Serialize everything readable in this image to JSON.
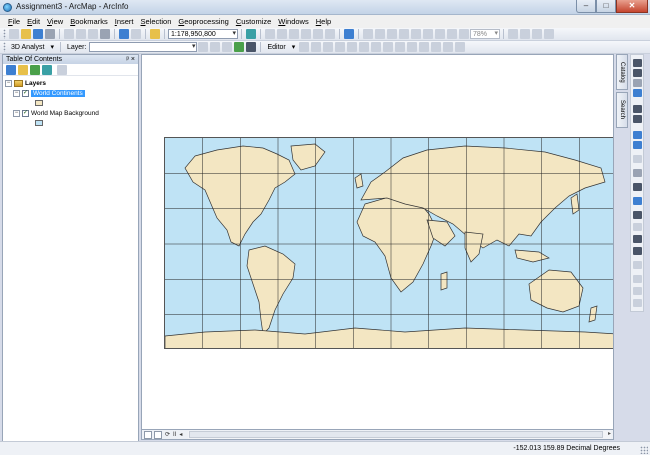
{
  "window": {
    "title": "Assignment3 - ArcMap - ArcInfo",
    "controls": {
      "minimize": "–",
      "maximize": "□",
      "close": "✕"
    }
  },
  "menu": [
    "File",
    "Edit",
    "View",
    "Bookmarks",
    "Insert",
    "Selection",
    "Geoprocessing",
    "Customize",
    "Windows",
    "Help"
  ],
  "toolbar": {
    "scale": "1:178,950,800",
    "analyst_label": "3D Analyst",
    "layer_label": "Layer:",
    "layer_value": "",
    "editor_label": "Editor",
    "zoom_percent": "78%"
  },
  "toc": {
    "title": "Table Of Contents",
    "controls": "ᵖ ×",
    "root_label": "Layers",
    "layers": [
      {
        "name": "World Continents",
        "checked": true,
        "selected": true,
        "swatch_color": "#f3e6c2"
      },
      {
        "name": "World Map Background",
        "checked": true,
        "selected": false,
        "swatch_color": "#bfe3f5"
      }
    ]
  },
  "side_tabs": [
    "Catalog",
    "Search"
  ],
  "map": {
    "ocean_color": "#bfe3f5",
    "land_color": "#f3e6c2",
    "outline_color": "#333333",
    "graticule_color": "#222222"
  },
  "map_bar": {
    "pause_label": "II"
  },
  "status": {
    "coords": "-152.013  159.89 Decimal Degrees"
  },
  "icons": [
    "new-icon",
    "open-icon",
    "save-icon",
    "print-icon",
    "cut-icon",
    "copy-icon",
    "paste-icon",
    "delete-icon",
    "undo-icon",
    "redo-icon",
    "add-data-icon",
    "zoom-in-icon",
    "zoom-out-icon",
    "pan-icon",
    "full-extent-icon",
    "back-icon",
    "forward-icon",
    "select-icon",
    "identify-icon",
    "find-icon",
    "measure-icon",
    "hyperlink-icon"
  ]
}
